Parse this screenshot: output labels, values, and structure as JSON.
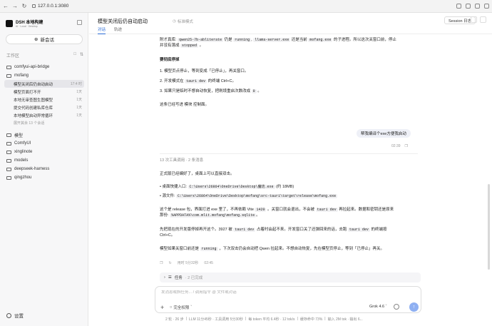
{
  "browser": {
    "url": "127.0.0.1:3080"
  },
  "sidebar": {
    "brand_name": "DSH 本地构建",
    "brand_sub": "AI · Local · Desktop",
    "new_chat": "新会话",
    "workspace_label": "工作区",
    "settings": "设置",
    "more": "展开其余 13 个会话",
    "tree": [
      {
        "type": "folder",
        "label": "comfyui-api-bridge"
      },
      {
        "type": "folder",
        "label": "mofang"
      },
      {
        "type": "conv",
        "label": "模型关闭后仍自动启动",
        "time": "17:4 时",
        "active": true
      },
      {
        "type": "conv",
        "label": "模型页面打不开",
        "time": "1天"
      },
      {
        "type": "conv",
        "label": "本地无审查图生图模型",
        "time": "1天"
      },
      {
        "type": "conv",
        "label": "提交代码创建私库仓库",
        "time": "1天"
      },
      {
        "type": "conv",
        "label": "本地模型启动异常循环",
        "time": "1天"
      },
      {
        "type": "more"
      },
      {
        "type": "folder",
        "label": "模型"
      },
      {
        "type": "folder",
        "label": "ComfyUI"
      },
      {
        "type": "folder",
        "label": "xinglinote"
      },
      {
        "type": "folder",
        "label": "models"
      },
      {
        "type": "folder",
        "label": "deepseek-harness"
      },
      {
        "type": "folder",
        "label": "qingzhou"
      }
    ]
  },
  "header": {
    "title": "模型关闭后仍自动启动",
    "mode": "标准模式",
    "tabs": [
      "对话",
      "轨迹"
    ],
    "session_log": "Session 日志"
  },
  "content": {
    "line1_pre": "附才真库:",
    "line1_code1": "qwen25-7b-abliterate",
    "line1_mid1": "仍是",
    "line1_code2": "running",
    "line1_mid2": ",",
    "line1_code3": "llama-server.exe",
    "line1_mid3": "还是当前",
    "line1_code4": "mofang.exe",
    "line1_tail": "的子进程。所以这次关窗口前，停止",
    "line2_pre": "并没有落成",
    "line2_code": "stopped",
    "line2_tail": "。",
    "heading": "要彻底停掉",
    "steps": [
      {
        "num": "1.",
        "text": "模型页点停止，等到变成「已停止」，再关窗口。"
      },
      {
        "num": "2.",
        "pre": "开发模式在",
        "code": "tauri dev",
        "tail": "的终端 Ctrl+C。"
      },
      {
        "num": "3.",
        "pre": "如果只是临时不想自动恢复，把刷境重启次数改成",
        "code": "0",
        "tail": "。"
      }
    ],
    "after_steps": "这条已经写进 模块 控制面。",
    "user_message": "帮我编译个exe方便我启动",
    "user_time": "02:39",
    "tool_calls": "13 次工具调用 · 2 条消息",
    "reply_intro": "正式版已经编好了，桌面上可以直接双击。",
    "bullet1_pre": "桌面快捷入口:",
    "bullet1_code": "C:\\Users\\26864\\OneDrive\\Desktop\\魔坊.exe",
    "bullet1_tail": "(约 18MB)",
    "bullet2_pre": "源文件:",
    "bullet2_code": "C:\\Users\\26864\\OneDrive\\Desktop\\mofang\\src-tauri\\target\\release\\mofang.exe",
    "para1_a": "这个是 release 包，界面打进 exe 里了，不再依赖 Vite",
    "para1_code1": "1420",
    "para1_b": "。关窗口就会退出，不会被",
    "para1_code2": "tauri dev",
    "para1_c": "再拉起来。数据和密钥还是原来",
    "para1_d": "那份:",
    "para1_code3": "%APPDATA%\\com.mlit.mofang\\mofang.sqlite",
    "para1_e": "。",
    "para2_a": "先把现在的开发版停掉再开这个。3927 被",
    "para2_code1": "tauri dev",
    "para2_b": "占着时会起不来。开发窗口关了还弹回来的话，去跑",
    "para2_code2": "tauri dev",
    "para2_c": "的终端按",
    "para2_d": "Ctrl+C。",
    "para3_a": "模型如果关窗口前还是",
    "para3_code": "running",
    "para3_b": "，下次双击仍会自动把 Qwen 拉起来。不想自动恢复，先在模型页停止，等到「已停止」再关。",
    "meta_time": "用时 5分32秒",
    "meta_clock": "02:45"
  },
  "taskbar": {
    "label": "任务",
    "sub": "· 2 已完成"
  },
  "composer": {
    "placeholder": "发消息或斜任务... / 调用指令 @ 文件或对话",
    "permission": "完全权限",
    "model": "Grok 4.6"
  },
  "statusbar": {
    "items": [
      "2 轮 · 26 步",
      "|",
      "LLM 11分45秒 · 工具调用 5分30秒",
      "|",
      "每 token 平均 6.4秒 · 12 tok/s",
      "|",
      "缓存命中 73%",
      "|",
      "输入 2M tok · 输出 6..."
    ]
  }
}
